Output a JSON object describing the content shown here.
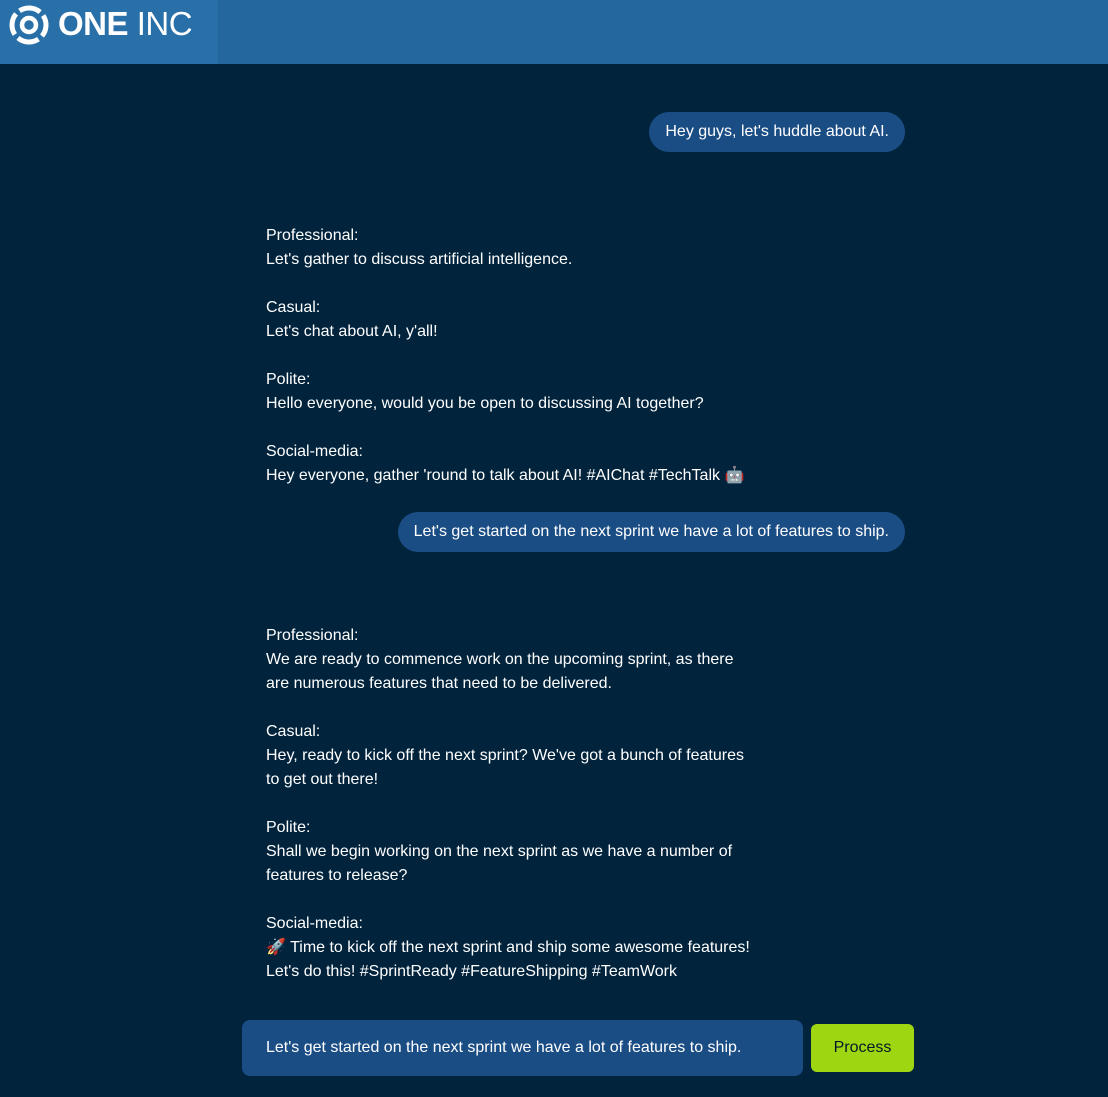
{
  "brand": {
    "logo_bold": "ONE",
    "logo_thin": "INC",
    "logo_icon": "one-inc-logo-icon"
  },
  "colors": {
    "header_bg": "#24679f",
    "page_bg": "#01233c",
    "bubble_bg": "#1b4d85",
    "process_button": "#9ed611"
  },
  "messages": [
    {
      "user": "Hey guys, let's huddle about AI.",
      "variants": [
        {
          "label": "Professional:",
          "text": "Let's gather to discuss artificial intelligence."
        },
        {
          "label": "Casual:",
          "text": "Let's chat about AI, y'all!"
        },
        {
          "label": "Polite:",
          "text": "Hello everyone, would you be open to discussing AI together?"
        },
        {
          "label": "Social-media:",
          "text": "Hey everyone, gather 'round to talk about AI! #AIChat #TechTalk 🤖"
        }
      ]
    },
    {
      "user": "Let's get started on the next sprint we have a lot of features to ship.",
      "variants": [
        {
          "label": "Professional:",
          "text": "We are ready to commence work on the upcoming sprint, as there\nare numerous features that need to be delivered."
        },
        {
          "label": "Casual:",
          "text": "Hey, ready to kick off the next sprint? We've got a bunch of features\nto get out there!"
        },
        {
          "label": "Polite:",
          "text": "Shall we begin working on the next sprint as we have a number of\nfeatures to release?"
        },
        {
          "label": "Social-media:",
          "text": "🚀 Time to kick off the next sprint and ship some awesome features!\nLet's do this! #SprintReady #FeatureShipping #TeamWork"
        }
      ]
    }
  ],
  "composer": {
    "value": "Let's get started on the next sprint we have a lot of features to ship.",
    "button_label": "Process"
  }
}
